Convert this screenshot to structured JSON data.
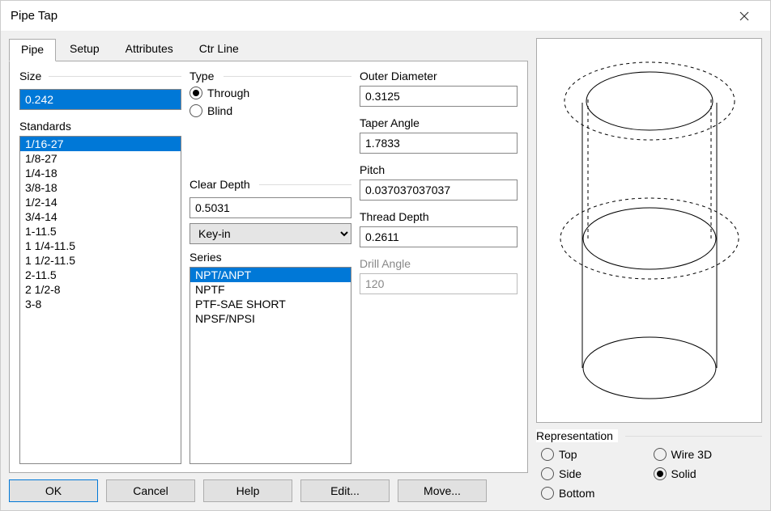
{
  "title": "Pipe Tap",
  "tabs": [
    "Pipe",
    "Setup",
    "Attributes",
    "Ctr Line"
  ],
  "activeTab": 0,
  "size": {
    "label": "Size",
    "value": "0.242"
  },
  "standards": {
    "label": "Standards",
    "items": [
      "1/16-27",
      "1/8-27",
      "1/4-18",
      "3/8-18",
      "1/2-14",
      "3/4-14",
      "1-11.5",
      "1 1/4-11.5",
      "1 1/2-11.5",
      "2-11.5",
      "2 1/2-8",
      "3-8"
    ],
    "selected": 0
  },
  "type": {
    "label": "Type",
    "options": [
      "Through",
      "Blind"
    ],
    "selected": 0
  },
  "clearDepth": {
    "label": "Clear Depth",
    "value": "0.5031",
    "mode": "Key-in"
  },
  "series": {
    "label": "Series",
    "items": [
      "NPT/ANPT",
      "NPTF",
      "PTF-SAE SHORT",
      "NPSF/NPSI"
    ],
    "selected": 0
  },
  "outerDiameter": {
    "label": "Outer Diameter",
    "value": "0.3125"
  },
  "taperAngle": {
    "label": "Taper Angle",
    "value": "1.7833"
  },
  "pitch": {
    "label": "Pitch",
    "value": "0.037037037037"
  },
  "threadDepth": {
    "label": "Thread Depth",
    "value": "0.2611"
  },
  "drillAngle": {
    "label": "Drill Angle",
    "value": "120",
    "disabled": true
  },
  "representation": {
    "label": "Representation",
    "options": [
      "Top",
      "Wire 3D",
      "Side",
      "Solid",
      "Bottom"
    ],
    "selected": 3
  },
  "buttons": {
    "ok": "OK",
    "cancel": "Cancel",
    "help": "Help",
    "edit": "Edit...",
    "move": "Move..."
  }
}
